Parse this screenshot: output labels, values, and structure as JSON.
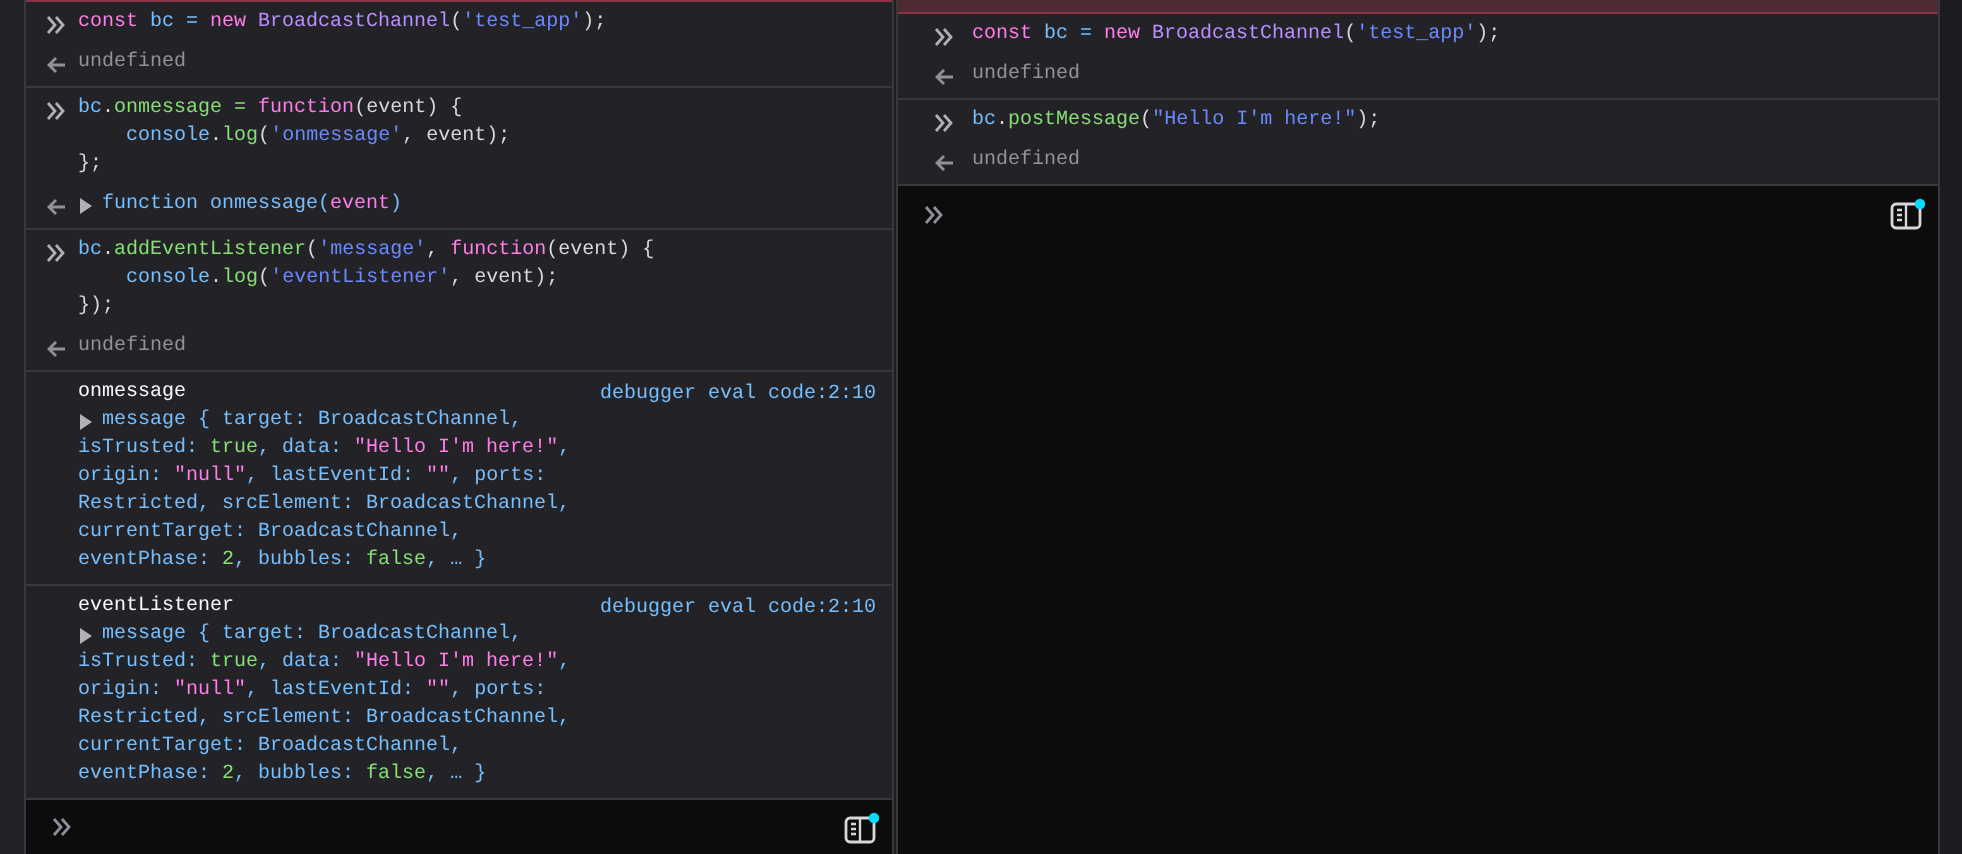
{
  "panels": [
    {
      "entries": [
        {
          "kind": "command",
          "code": [
            [
              {
                "text": "const ",
                "color": "#ff7de9"
              },
              {
                "text": "bc =",
                "color": "#75bfff"
              },
              {
                "text": " new ",
                "color": "#ff7de9"
              },
              {
                "text": "BroadcastChannel",
                "color": "#b98eff"
              },
              {
                "text": "(",
                "color": "#d7d7db"
              },
              {
                "text": "'test_app'",
                "color": "#6b89ff"
              },
              {
                "text": ");",
                "color": "#d7d7db"
              }
            ]
          ],
          "result": {
            "kind": "undefined",
            "parts": [
              {
                "text": "undefined",
                "color": "#939395"
              }
            ]
          }
        },
        {
          "kind": "command",
          "code": [
            [
              {
                "text": "bc",
                "color": "#75bfff"
              },
              {
                "text": ".",
                "color": "#d7d7db"
              },
              {
                "text": "onmessage =",
                "color": "#86de74"
              },
              {
                "text": " function",
                "color": "#ff7de9"
              },
              {
                "text": "(event) {",
                "color": "#d7d7db"
              }
            ],
            [
              {
                "text": "    console",
                "color": "#75bfff"
              },
              {
                "text": ".",
                "color": "#d7d7db"
              },
              {
                "text": "log",
                "color": "#86de74"
              },
              {
                "text": "(",
                "color": "#d7d7db"
              },
              {
                "text": "'onmessage'",
                "color": "#6b89ff"
              },
              {
                "text": ", event);",
                "color": "#d7d7db"
              }
            ],
            [
              {
                "text": "};",
                "color": "#d7d7db"
              }
            ]
          ],
          "result": {
            "kind": "function",
            "expanded": false,
            "parts": [
              {
                "text": "function onmessage(",
                "color": "#75bfff"
              },
              {
                "text": "event",
                "color": "#ff7de9"
              },
              {
                "text": ")",
                "color": "#75bfff"
              }
            ]
          }
        },
        {
          "kind": "command",
          "code": [
            [
              {
                "text": "bc",
                "color": "#75bfff"
              },
              {
                "text": ".",
                "color": "#d7d7db"
              },
              {
                "text": "addEventListener",
                "color": "#86de74"
              },
              {
                "text": "(",
                "color": "#d7d7db"
              },
              {
                "text": "'message'",
                "color": "#6b89ff"
              },
              {
                "text": ", ",
                "color": "#d7d7db"
              },
              {
                "text": "function",
                "color": "#ff7de9"
              },
              {
                "text": "(event) {",
                "color": "#d7d7db"
              }
            ],
            [
              {
                "text": "    console",
                "color": "#75bfff"
              },
              {
                "text": ".",
                "color": "#d7d7db"
              },
              {
                "text": "log",
                "color": "#86de74"
              },
              {
                "text": "(",
                "color": "#d7d7db"
              },
              {
                "text": "'eventListener'",
                "color": "#6b89ff"
              },
              {
                "text": ", event);",
                "color": "#d7d7db"
              }
            ],
            [
              {
                "text": "});",
                "color": "#d7d7db"
              }
            ]
          ],
          "result": {
            "kind": "undefined",
            "parts": [
              {
                "text": "undefined",
                "color": "#939395"
              }
            ]
          }
        },
        {
          "kind": "log",
          "label": "onmessage",
          "location": "debugger eval code:2:10",
          "expanded": false,
          "message": [
            [
              {
                "text": "message { target: BroadcastChannel,",
                "color": "#75bfff"
              }
            ],
            [
              {
                "text": "isTrusted: ",
                "color": "#75bfff"
              },
              {
                "text": "true",
                "color": "#86de74"
              },
              {
                "text": ", data: ",
                "color": "#75bfff"
              },
              {
                "text": "\"Hello I'm here!\"",
                "color": "#ff7de9"
              },
              {
                "text": ",",
                "color": "#75bfff"
              }
            ],
            [
              {
                "text": "origin: ",
                "color": "#75bfff"
              },
              {
                "text": "\"null\"",
                "color": "#ff7de9"
              },
              {
                "text": ", lastEventId: ",
                "color": "#75bfff"
              },
              {
                "text": "\"\"",
                "color": "#ff7de9"
              },
              {
                "text": ", ports:",
                "color": "#75bfff"
              }
            ],
            [
              {
                "text": "Restricted, srcElement: BroadcastChannel,",
                "color": "#75bfff"
              }
            ],
            [
              {
                "text": "currentTarget: BroadcastChannel,",
                "color": "#75bfff"
              }
            ],
            [
              {
                "text": "eventPhase: ",
                "color": "#75bfff"
              },
              {
                "text": "2",
                "color": "#86de74"
              },
              {
                "text": ", bubbles: ",
                "color": "#75bfff"
              },
              {
                "text": "false",
                "color": "#86de74"
              },
              {
                "text": ", … }",
                "color": "#75bfff"
              }
            ]
          ]
        },
        {
          "kind": "log",
          "label": "eventListener",
          "location": "debugger eval code:2:10",
          "expanded": false,
          "message": [
            [
              {
                "text": "message { target: BroadcastChannel,",
                "color": "#75bfff"
              }
            ],
            [
              {
                "text": "isTrusted: ",
                "color": "#75bfff"
              },
              {
                "text": "true",
                "color": "#86de74"
              },
              {
                "text": ", data: ",
                "color": "#75bfff"
              },
              {
                "text": "\"Hello I'm here!\"",
                "color": "#ff7de9"
              },
              {
                "text": ",",
                "color": "#75bfff"
              }
            ],
            [
              {
                "text": "origin: ",
                "color": "#75bfff"
              },
              {
                "text": "\"null\"",
                "color": "#ff7de9"
              },
              {
                "text": ", lastEventId: ",
                "color": "#75bfff"
              },
              {
                "text": "\"\"",
                "color": "#ff7de9"
              },
              {
                "text": ", ports:",
                "color": "#75bfff"
              }
            ],
            [
              {
                "text": "Restricted, srcElement: BroadcastChannel,",
                "color": "#75bfff"
              }
            ],
            [
              {
                "text": "currentTarget: BroadcastChannel,",
                "color": "#75bfff"
              }
            ],
            [
              {
                "text": "eventPhase: ",
                "color": "#75bfff"
              },
              {
                "text": "2",
                "color": "#86de74"
              },
              {
                "text": ", bubbles: ",
                "color": "#75bfff"
              },
              {
                "text": "false",
                "color": "#86de74"
              },
              {
                "text": ", … }",
                "color": "#75bfff"
              }
            ]
          ]
        }
      ]
    },
    {
      "entries": [
        {
          "kind": "command",
          "code": [
            [
              {
                "text": "const ",
                "color": "#ff7de9"
              },
              {
                "text": "bc =",
                "color": "#75bfff"
              },
              {
                "text": " new ",
                "color": "#ff7de9"
              },
              {
                "text": "BroadcastChannel",
                "color": "#b98eff"
              },
              {
                "text": "(",
                "color": "#d7d7db"
              },
              {
                "text": "'test_app'",
                "color": "#6b89ff"
              },
              {
                "text": ");",
                "color": "#d7d7db"
              }
            ]
          ],
          "result": {
            "kind": "undefined",
            "parts": [
              {
                "text": "undefined",
                "color": "#939395"
              }
            ]
          }
        },
        {
          "kind": "command",
          "code": [
            [
              {
                "text": "bc",
                "color": "#75bfff"
              },
              {
                "text": ".",
                "color": "#d7d7db"
              },
              {
                "text": "postMessage",
                "color": "#86de74"
              },
              {
                "text": "(",
                "color": "#d7d7db"
              },
              {
                "text": "\"Hello I'm here!\"",
                "color": "#6b89ff"
              },
              {
                "text": ");",
                "color": "#d7d7db"
              }
            ]
          ],
          "result": {
            "kind": "undefined",
            "parts": [
              {
                "text": "undefined",
                "color": "#939395"
              }
            ]
          }
        }
      ]
    }
  ]
}
